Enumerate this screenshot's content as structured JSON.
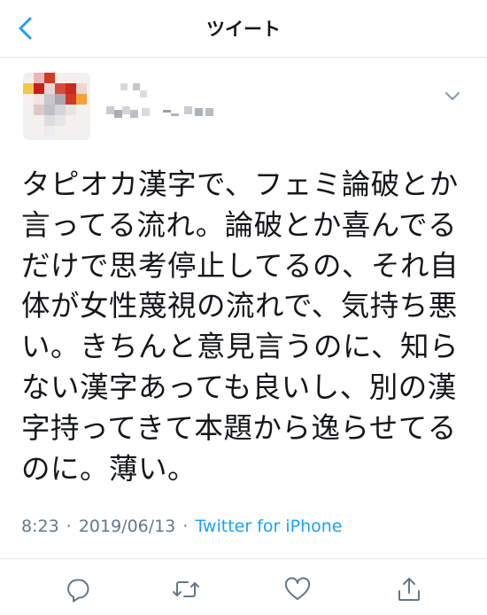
{
  "header": {
    "title": "ツイート",
    "back_icon": "chevron-left-icon"
  },
  "colors": {
    "accent": "#1da1f2",
    "text": "#14171a",
    "secondary": "#657786",
    "divider": "#e1e8ed"
  },
  "tweet": {
    "lines": [
      "タピオカ漢字で、フェミ論破とか",
      "言ってる流れ。論破とか喜んでる",
      "だけで思考停止してるの、それ自",
      "体が女性蔑視の流れで、気持ち悪",
      "い。きちんと意見言うのに、知ら",
      "ない漢字あっても良いし、別の漢",
      "字持ってきて本題から逸らせてる",
      "のに。薄い。"
    ],
    "time": "8:23",
    "date": "2019/06/13",
    "separator": "·",
    "source": "Twitter for iPhone"
  },
  "actions": [
    {
      "name": "reply-icon"
    },
    {
      "name": "retweet-icon"
    },
    {
      "name": "like-icon"
    },
    {
      "name": "share-icon"
    }
  ]
}
